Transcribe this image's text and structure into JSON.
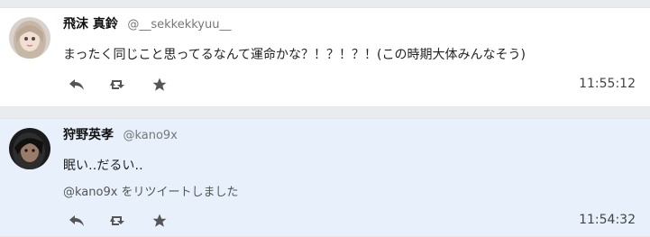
{
  "tweets": [
    {
      "name": "飛沫 真鈴",
      "handle": "@__sekkekkyuu__",
      "text": "まったく同じこと思ってるなんて運命かな？！？！？！(この時期大体みんなそう)",
      "time": "11:55:12",
      "avatar": "avatar-photo-light-hair"
    },
    {
      "name": "狩野英孝",
      "handle": "@kano9x",
      "text": "眠い‥だるい‥",
      "retweet_note": "@kano9x をリツイートしました",
      "time": "11:54:32",
      "avatar": "avatar-photo-dark-hair"
    }
  ],
  "icons": {
    "reply": "reply-icon",
    "retweet": "retweet-icon",
    "favorite": "star-icon"
  },
  "colors": {
    "background": "#e9ecef",
    "tweet_bg": "#ffffff",
    "highlight_bg": "#e7f0fb",
    "icon": "#555555"
  }
}
